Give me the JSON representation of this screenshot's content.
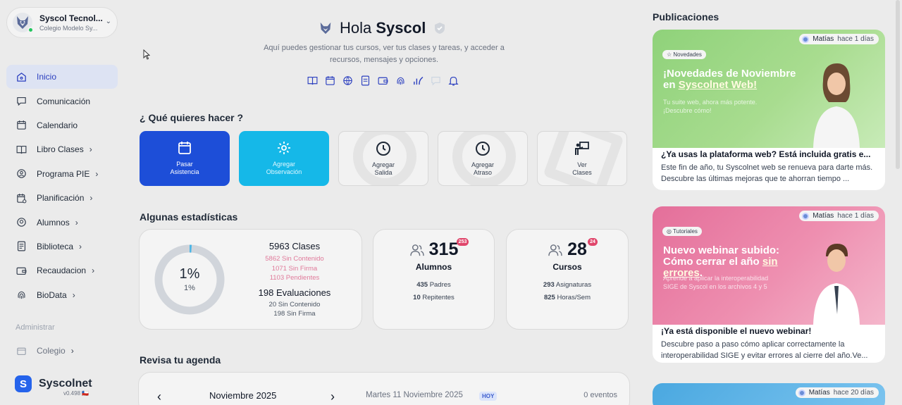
{
  "profile": {
    "name": "Syscol Tecnol...",
    "school": "Colegio Modelo Sy..."
  },
  "nav": {
    "items": [
      {
        "label": "Inicio",
        "icon": "home-icon",
        "chevron": ""
      },
      {
        "label": "Comunicación",
        "icon": "chat-icon",
        "chevron": ""
      },
      {
        "label": "Calendario",
        "icon": "calendar-icon",
        "chevron": ""
      },
      {
        "label": "Libro Clases",
        "icon": "book-icon",
        "chevron": "›"
      },
      {
        "label": "Programa PIE",
        "icon": "badge-icon",
        "chevron": "›"
      },
      {
        "label": "Planificación",
        "icon": "planning-icon",
        "chevron": "›"
      },
      {
        "label": "Alumnos",
        "icon": "student-icon",
        "chevron": "›"
      },
      {
        "label": "Biblioteca",
        "icon": "library-icon",
        "chevron": "›"
      },
      {
        "label": "Recaudacion",
        "icon": "wallet-icon",
        "chevron": "›"
      },
      {
        "label": "BioData",
        "icon": "fingerprint-icon",
        "chevron": "›"
      }
    ],
    "admin_title": "Administrar",
    "admin_items": [
      {
        "label": "Colegio",
        "chevron": "›"
      }
    ]
  },
  "brand": {
    "logo": "S",
    "name": "Syscolnet",
    "version": "v0.498 🇨🇱"
  },
  "hello": {
    "greeting": "Hola",
    "name": "Syscol",
    "subtitle": "Aquí puedes gestionar tus cursos, ver tus clases y tareas, y acceder a recursos, mensajes y opciones."
  },
  "quick_icons": [
    "book-icon",
    "calendar-icon",
    "basketball-icon",
    "document-icon",
    "wallet-icon",
    "fingerprint-icon",
    "chart-icon",
    "chat-icon",
    "bell-icon"
  ],
  "actions_title": "¿ Qué quieres hacer ?",
  "actions": [
    {
      "label": "Pasar Asistencia",
      "style": "blue",
      "icon": "calendar-icon"
    },
    {
      "label": "Agregar Observación",
      "style": "cyan",
      "icon": "gear-icon"
    },
    {
      "label": "Agregar Salida",
      "style": "light",
      "icon": "clock-icon"
    },
    {
      "label": "Agregar Atraso",
      "style": "light",
      "icon": "clock-icon"
    },
    {
      "label": "Ver Clases",
      "style": "light",
      "icon": "teacher-icon"
    }
  ],
  "stats_title": "Algunas estadísticas",
  "stats": {
    "percent_big": "1%",
    "percent_small": "1%",
    "progress_fraction": 0.01,
    "clases": "5963 Clases",
    "sin_contenido": "5862 Sin Contenido",
    "sin_firma": "1071 Sin Firma",
    "pendientes": "1103 Pendientes",
    "evaluaciones": "198 Evaluaciones",
    "eval_sin_contenido": "20 Sin Contenido",
    "eval_sin_firma": "198 Sin Firma"
  },
  "alumnos": {
    "count": "315",
    "badge": "253",
    "label": "Alumnos",
    "padres_num": "435",
    "padres_label": "Padres",
    "repitentes_num": "10",
    "repitentes_label": "Repitentes"
  },
  "cursos": {
    "count": "28",
    "badge": "24",
    "label": "Cursos",
    "asig_num": "293",
    "asig_label": "Asignaturas",
    "horas_num": "825",
    "horas_label": "Horas/Sem"
  },
  "agenda": {
    "title": "Revisa tu agenda",
    "month": "Noviembre  2025",
    "date": "Martes 11 Noviembre 2025",
    "today": "HOY",
    "events": "0 eventos",
    "prev": "‹",
    "next": "›"
  },
  "publications": {
    "title": "Publicaciones",
    "items": [
      {
        "author": "Matías",
        "ago": "hace 1 días",
        "tag": "☆ Novedades",
        "headline_a": "¡Novedades de Noviembre en ",
        "headline_hl": "Syscolnet Web!",
        "headline_b": "",
        "image_sub": "Tu suite web, ahora más potente. ¡Descubre cómo!",
        "title": "¿Ya usas la plataforma web? Está incluida gratis e...",
        "desc": "Este fin de año, tu Syscolnet web se renueva para darte más. Descubre las últimas mejoras que te ahorran tiempo ..."
      },
      {
        "author": "Matías",
        "ago": "hace 1 días",
        "tag": "◎ Tutoriales",
        "headline_a": "Nuevo webinar subido: Cómo cerrar el año ",
        "headline_hl": "sin errores",
        "headline_b": ".",
        "image_sub": "Aprende a aplicar la interoperabilidad SIGE de Syscol en los archivos 4 y 5",
        "title": "¡Ya está disponible el nuevo webinar!",
        "desc": "Descubre paso a paso cómo aplicar correctamente la interoperabilidad SIGE y evitar errores al cierre del año.Ve..."
      },
      {
        "author": "Matías",
        "ago": "hace 20 días"
      }
    ]
  }
}
